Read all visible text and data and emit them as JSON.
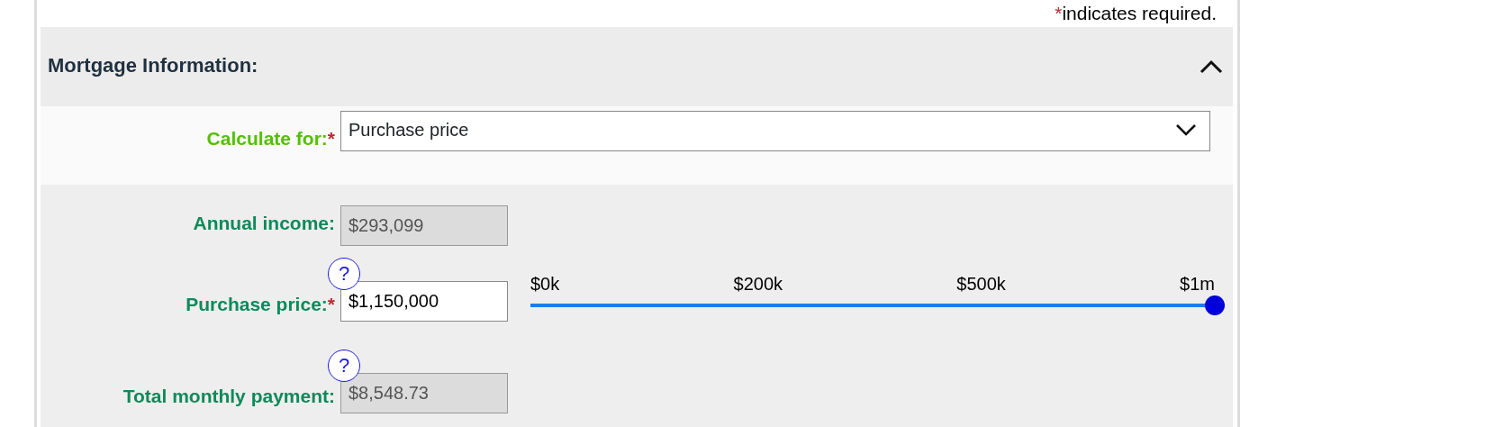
{
  "required_note": {
    "mark": "*",
    "text": "indicates required."
  },
  "section": {
    "title": "Mortgage Information:",
    "expanded": true
  },
  "fields": [
    {
      "kind": "select",
      "label": "Calculate for:",
      "required_mark": "*",
      "value": "Purchase price",
      "disabled": false
    },
    {
      "kind": "input",
      "label": "Annual income:",
      "value": "$293,099",
      "disabled": true
    },
    {
      "kind": "input",
      "label": "Purchase price:",
      "required_mark": "*",
      "help_mark": "?",
      "value": "$1,150,000",
      "disabled": false,
      "slider": {
        "level": 1.0,
        "ticks": [
          "$0k",
          "$200k",
          "$500k",
          "$1m"
        ]
      }
    },
    {
      "kind": "input",
      "label": "Total monthly payment:",
      "help_mark": "?",
      "value": "$8,548.73",
      "disabled": true
    }
  ]
}
